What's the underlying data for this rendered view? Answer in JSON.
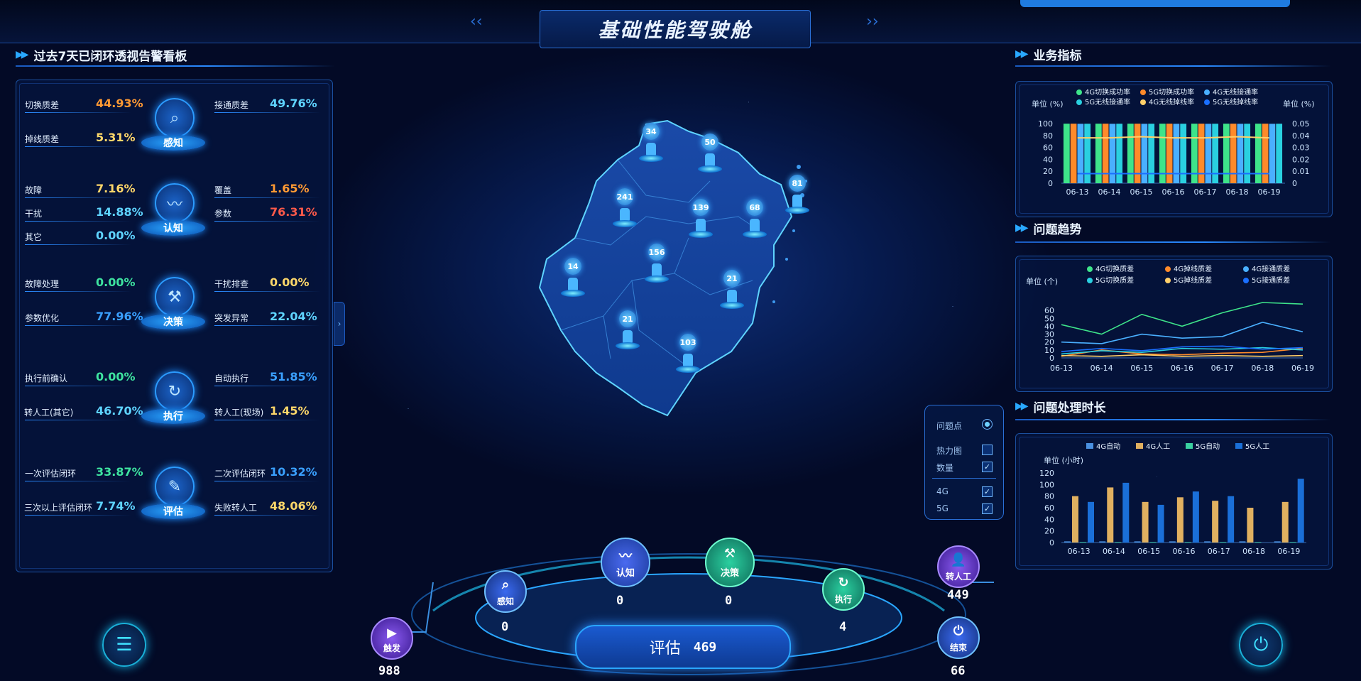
{
  "header": {
    "title": "基础性能驾驶舱"
  },
  "left_panel": {
    "title": "过去7天已闭环透视告警看板",
    "stages": [
      {
        "name": "感知",
        "rows": [
          {
            "label": "切换质差",
            "value": "44.93%",
            "color": "orange"
          },
          {
            "label": "接通质差",
            "value": "49.76%",
            "color": "cyan"
          },
          {
            "label": "掉线质差",
            "value": "5.31%",
            "color": "yellow"
          }
        ]
      },
      {
        "name": "认知",
        "rows": [
          {
            "label": "故障",
            "value": "7.16%",
            "color": "yellow"
          },
          {
            "label": "覆盖",
            "value": "1.65%",
            "color": "orange"
          },
          {
            "label": "干扰",
            "value": "14.88%",
            "color": "cyan"
          },
          {
            "label": "参数",
            "value": "76.31%",
            "color": "red"
          },
          {
            "label": "其它",
            "value": "0.00%",
            "color": "cyan"
          }
        ]
      },
      {
        "name": "决策",
        "rows": [
          {
            "label": "故障处理",
            "value": "0.00%",
            "color": "green"
          },
          {
            "label": "干扰排查",
            "value": "0.00%",
            "color": "yellow"
          },
          {
            "label": "参数优化",
            "value": "77.96%",
            "color": "blue"
          },
          {
            "label": "突发异常",
            "value": "22.04%",
            "color": "cyan"
          }
        ]
      },
      {
        "name": "执行",
        "rows": [
          {
            "label": "执行前确认",
            "value": "0.00%",
            "color": "green"
          },
          {
            "label": "自动执行",
            "value": "51.85%",
            "color": "blue"
          },
          {
            "label": "转人工(其它)",
            "value": "46.70%",
            "color": "cyan"
          },
          {
            "label": "转人工(现场)",
            "value": "1.45%",
            "color": "yellow"
          }
        ]
      },
      {
        "name": "评估",
        "rows": [
          {
            "label": "一次评估闭环",
            "value": "33.87%",
            "color": "green"
          },
          {
            "label": "二次评估闭环",
            "value": "10.32%",
            "color": "blue"
          },
          {
            "label": "三次以上评估闭环",
            "value": "7.74%",
            "color": "cyan"
          },
          {
            "label": "失败转人工",
            "value": "48.06%",
            "color": "yellow"
          }
        ]
      }
    ]
  },
  "map": {
    "points": [
      {
        "value": "34"
      },
      {
        "value": "50"
      },
      {
        "value": "81"
      },
      {
        "value": "241"
      },
      {
        "value": "139"
      },
      {
        "value": "68"
      },
      {
        "value": "14"
      },
      {
        "value": "156"
      },
      {
        "value": "21"
      },
      {
        "value": "21"
      },
      {
        "value": "103"
      }
    ],
    "legend_control": {
      "problem_points": "问题点",
      "heatmap": "热力图",
      "count": "数量",
      "g4": "4G",
      "g5": "5G"
    }
  },
  "flow": {
    "trigger": {
      "label": "触发",
      "value": "988"
    },
    "perceive": {
      "label": "感知",
      "value": "0"
    },
    "cognize": {
      "label": "认知",
      "value": "0"
    },
    "decide": {
      "label": "决策",
      "value": "0"
    },
    "execute": {
      "label": "执行",
      "value": "4"
    },
    "manual": {
      "label": "转人工",
      "value": "449"
    },
    "end": {
      "label": "结束",
      "value": "66"
    },
    "evaluate": {
      "label": "评估",
      "value": "469"
    }
  },
  "right_panel": {
    "kpi_title": "业务指标",
    "trend_title": "问题趋势",
    "duration_title": "问题处理时长"
  },
  "chart_data": [
    {
      "type": "bar",
      "title": "业务指标",
      "ylabel": "单位 (%)",
      "y2label": "单位 (%)",
      "categories": [
        "06-13",
        "06-14",
        "06-15",
        "06-16",
        "06-17",
        "06-18",
        "06-19"
      ],
      "ylim": [
        0,
        100
      ],
      "y2lim": [
        0,
        0.05
      ],
      "yticks": [
        0,
        20,
        40,
        60,
        80,
        100
      ],
      "y2ticks": [
        0,
        0.01,
        0.02,
        0.03,
        0.04,
        0.05
      ],
      "series": [
        {
          "name": "4G切换成功率",
          "color": "#3ee48a",
          "values": [
            99.8,
            99.8,
            99.8,
            99.8,
            99.8,
            99.8,
            99.8
          ]
        },
        {
          "name": "5G切换成功率",
          "color": "#ff8a2a",
          "values": [
            99.8,
            99.8,
            99.8,
            99.8,
            99.8,
            99.8,
            99.8
          ]
        },
        {
          "name": "4G无线接通率",
          "color": "#4ab0ff",
          "values": [
            99.6,
            99.6,
            99.6,
            99.6,
            99.6,
            99.6,
            99.6
          ]
        },
        {
          "name": "5G无线接通率",
          "color": "#2ad0e0",
          "values": [
            99.7,
            99.7,
            99.7,
            99.7,
            99.7,
            99.7,
            99.7
          ]
        },
        {
          "name": "4G无线掉线率",
          "color": "#ffd06a",
          "type": "line",
          "axis": "right",
          "values": [
            0.038,
            0.038,
            0.039,
            0.038,
            0.038,
            0.039,
            0.038
          ]
        },
        {
          "name": "5G无线掉线率",
          "color": "#1a6fff",
          "type": "line",
          "axis": "right",
          "values": [
            0.008,
            0.008,
            0.008,
            0.008,
            0.008,
            0.008,
            0.008
          ]
        }
      ]
    },
    {
      "type": "line",
      "title": "问题趋势",
      "ylabel": "单位 (个)",
      "categories": [
        "06-13",
        "06-14",
        "06-15",
        "06-16",
        "06-17",
        "06-18",
        "06-19"
      ],
      "ylim": [
        0,
        70
      ],
      "yticks": [
        0,
        10,
        20,
        30,
        40,
        50,
        60
      ],
      "series": [
        {
          "name": "4G切换质差",
          "color": "#3ee48a",
          "values": [
            42,
            30,
            55,
            40,
            57,
            70,
            68
          ]
        },
        {
          "name": "4G掉线质差",
          "color": "#ff8a2a",
          "values": [
            2,
            10,
            5,
            4,
            6,
            7,
            12
          ]
        },
        {
          "name": "4G接通质差",
          "color": "#4ab0ff",
          "values": [
            20,
            18,
            30,
            25,
            27,
            45,
            33
          ]
        },
        {
          "name": "5G切换质差",
          "color": "#2ad0e0",
          "values": [
            5,
            9,
            7,
            12,
            11,
            13,
            10
          ]
        },
        {
          "name": "5G掉线质差",
          "color": "#ffd06a",
          "values": [
            3,
            2,
            4,
            2,
            3,
            2,
            3
          ]
        },
        {
          "name": "5G接通质差",
          "color": "#1a6fff",
          "values": [
            8,
            12,
            9,
            14,
            15,
            11,
            13
          ]
        }
      ]
    },
    {
      "type": "bar",
      "title": "问题处理时长",
      "ylabel": "单位 (小时)",
      "categories": [
        "06-13",
        "06-14",
        "06-15",
        "06-16",
        "06-17",
        "06-18",
        "06-19"
      ],
      "ylim": [
        0,
        120
      ],
      "yticks": [
        0,
        20,
        40,
        60,
        80,
        100,
        120
      ],
      "series": [
        {
          "name": "4G自动",
          "color": "#4a90e0",
          "values": [
            2,
            2,
            2,
            2,
            2,
            2,
            2
          ]
        },
        {
          "name": "4G人工",
          "color": "#e0b060",
          "values": [
            80,
            95,
            70,
            78,
            72,
            60,
            70
          ]
        },
        {
          "name": "5G自动",
          "color": "#3ad0a0",
          "values": [
            1,
            1,
            1,
            1,
            1,
            1,
            1
          ]
        },
        {
          "name": "5G人工",
          "color": "#1a6fd8",
          "values": [
            70,
            103,
            65,
            88,
            80,
            0,
            110
          ]
        }
      ]
    }
  ]
}
